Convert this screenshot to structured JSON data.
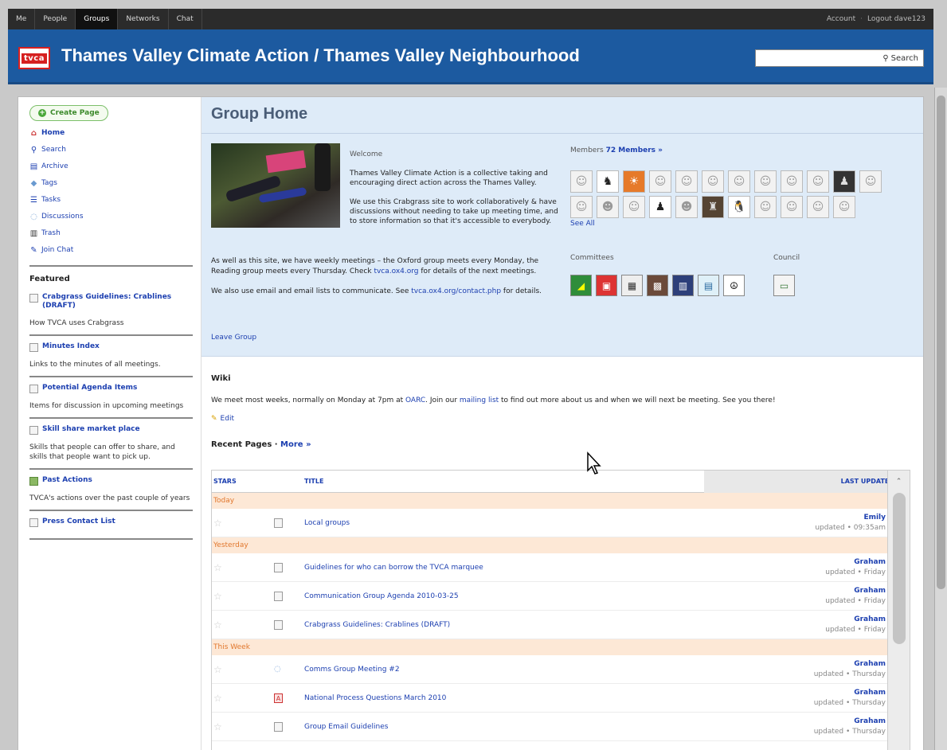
{
  "topnav": {
    "tabs": [
      "Me",
      "People",
      "Groups",
      "Networks",
      "Chat"
    ],
    "active": "Groups",
    "account": "Account",
    "logout": "Logout dave123"
  },
  "colors": {
    "banner": "#1c5aa0",
    "topbar": "#2b2b2b",
    "header_bg": "#deebf8",
    "today_band": "#fde8d6",
    "link": "#1c3fb0"
  },
  "banner": {
    "logo_text": "tvca",
    "title": "Thames Valley Climate Action / Thames Valley Neighbourhood",
    "search_label": "Search",
    "search_value": ""
  },
  "sidebar": {
    "create_page": "Create Page",
    "nav": [
      {
        "label": "Home",
        "icon": "home-icon"
      },
      {
        "label": "Search",
        "icon": "search-icon"
      },
      {
        "label": "Archive",
        "icon": "archive-icon"
      },
      {
        "label": "Tags",
        "icon": "tag-icon"
      },
      {
        "label": "Tasks",
        "icon": "tasks-icon"
      },
      {
        "label": "Discussions",
        "icon": "discussion-icon"
      },
      {
        "label": "Trash",
        "icon": "trash-icon"
      },
      {
        "label": "Join Chat",
        "icon": "chat-icon"
      }
    ],
    "featured_heading": "Featured",
    "featured": [
      {
        "title": "Crabgrass Guidelines: Crablines (DRAFT)",
        "desc": "How TVCA uses Crabgrass"
      },
      {
        "title": "Minutes Index",
        "desc": "Links to the minutes of all meetings."
      },
      {
        "title": "Potential Agenda Items",
        "desc": "Items for discussion in upcoming meetings"
      },
      {
        "title": "Skill share market place",
        "desc": "Skills that people can offer to share, and skills that people want to pick up."
      },
      {
        "title": "Past Actions",
        "desc": "TVCA's actions over the past couple of years"
      },
      {
        "title": "Press Contact List",
        "desc": ""
      }
    ]
  },
  "group": {
    "title": "Group Home",
    "welcome_heading": "Welcome",
    "welcome_p1": "Thames Valley Climate Action is a collective taking and encouraging direct action across the Thames Valley.",
    "welcome_p2": "We use this Crabgrass site to work collaboratively & have discussions without needing to take up meeting time, and to store information so that it's accessible to everybody.",
    "about_p1a": "As well as this site, we have weekly meetings – the Oxford group meets every Monday, the Reading group meets every Thursday. Check ",
    "about_p1_link": "tvca.ox4.org",
    "about_p1b": " for details of the next meetings.",
    "about_p2a": "We also use email and email lists to communicate. See ",
    "about_p2_link": "tvca.ox4.org/contact.php",
    "about_p2b": " for details.",
    "leave_group": "Leave Group",
    "members_label": "Members",
    "members_link": "72 Members »",
    "see_all": "See All",
    "committees_label": "Committees",
    "council_label": "Council"
  },
  "wiki": {
    "heading": "Wiki",
    "text_a": "We meet most weeks, normally on Monday at 7pm at ",
    "link1": "OARC",
    "text_b": ". Join our ",
    "link2": "mailing list",
    "text_c": " to find out more about us and when we will next be meeting. See you there!",
    "edit": "Edit"
  },
  "recent": {
    "heading": "Recent Pages",
    "more": "More »",
    "columns": {
      "stars": "STARS",
      "title": "TITLE",
      "updated": "LAST UPDATED"
    },
    "groups": [
      {
        "label": "Today",
        "rows": [
          {
            "type": "doc",
            "title": "Local groups",
            "who": "Emily",
            "when": "updated • 09:35am"
          }
        ]
      },
      {
        "label": "Yesterday",
        "rows": [
          {
            "type": "doc",
            "title": "Guidelines for who can borrow the TVCA marquee",
            "who": "Graham",
            "when": "updated • Friday"
          },
          {
            "type": "doc",
            "title": "Communication Group Agenda 2010-03-25",
            "who": "Graham",
            "when": "updated • Friday"
          },
          {
            "type": "doc",
            "title": "Crabgrass Guidelines: Crablines (DRAFT)",
            "who": "Graham",
            "when": "updated • Friday"
          }
        ]
      },
      {
        "label": "This Week",
        "rows": [
          {
            "type": "disc",
            "title": "Comms Group Meeting #2",
            "who": "Graham",
            "when": "updated • Thursday"
          },
          {
            "type": "pdf",
            "title": "National Process Questions March 2010",
            "who": "Graham",
            "when": "updated • Thursday"
          },
          {
            "type": "doc",
            "title": "Group Email Guidelines",
            "who": "Graham",
            "when": "updated • Thursday"
          }
        ]
      }
    ]
  }
}
